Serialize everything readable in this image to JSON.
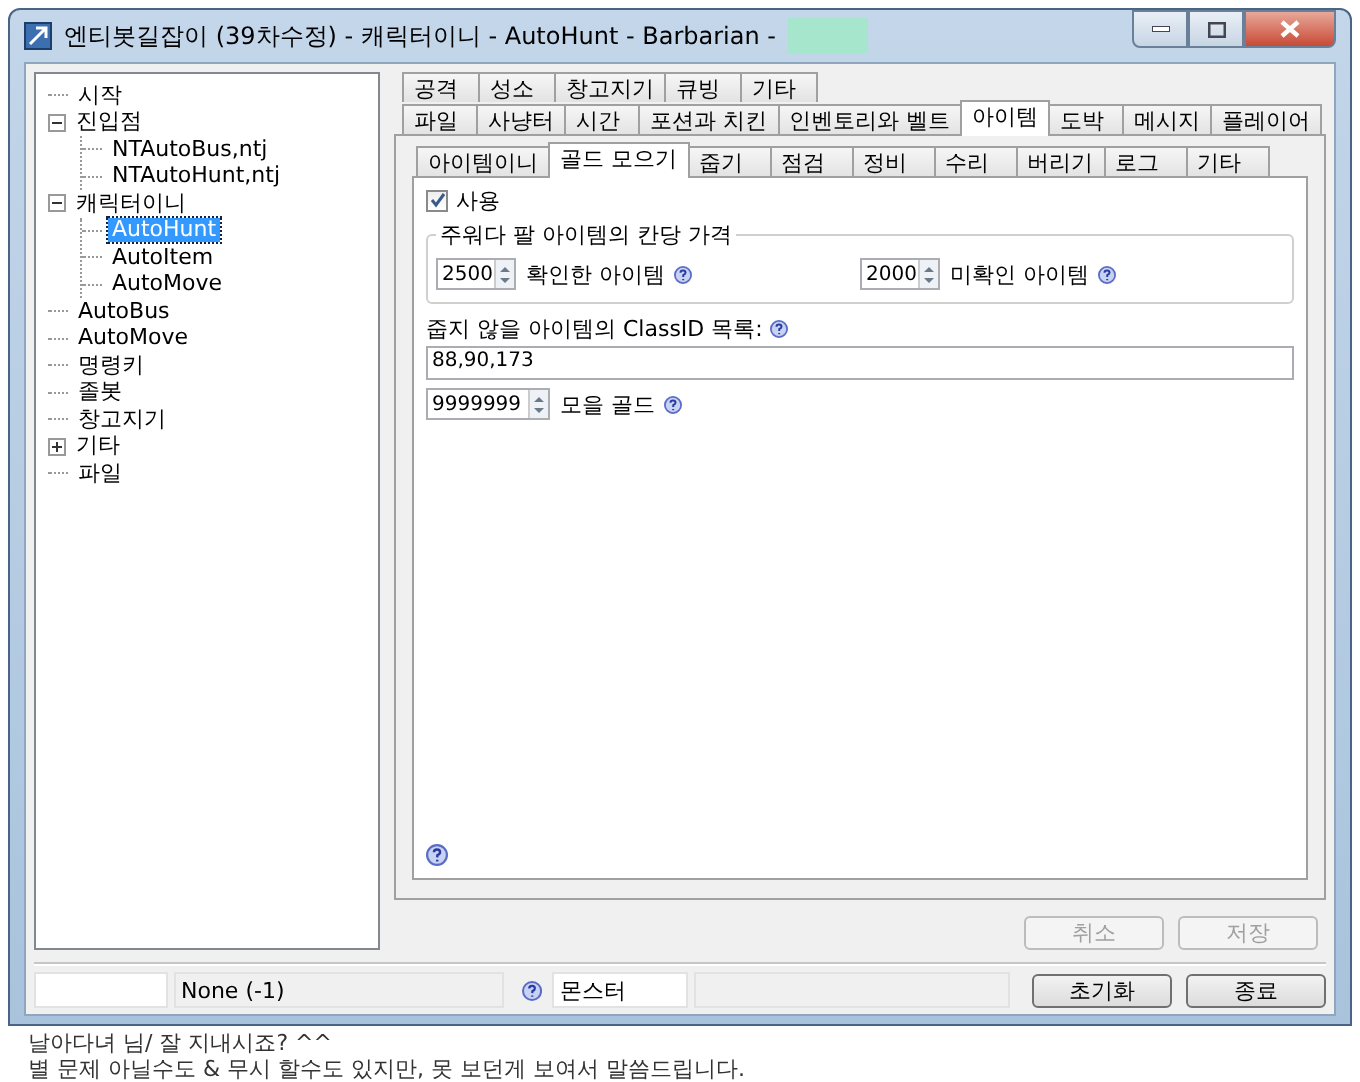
{
  "window": {
    "title": "엔티봇길잡이 (39차수정) - 캐릭터이니 - AutoHunt - Barbarian -"
  },
  "tree": [
    {
      "label": "시작",
      "selected": false
    },
    {
      "label": "진입점",
      "selected": false,
      "expanded": true,
      "children": [
        {
          "label": "NTAutoBus,ntj",
          "selected": false
        },
        {
          "label": "NTAutoHunt,ntj",
          "selected": false
        }
      ]
    },
    {
      "label": "캐릭터이니",
      "selected": false,
      "expanded": true,
      "children": [
        {
          "label": "AutoHunt",
          "selected": true
        },
        {
          "label": "AutoItem",
          "selected": false
        },
        {
          "label": "AutoMove",
          "selected": false
        }
      ]
    },
    {
      "label": "AutoBus",
      "selected": false
    },
    {
      "label": "AutoMove",
      "selected": false
    },
    {
      "label": "명령키",
      "selected": false
    },
    {
      "label": "졸봇",
      "selected": false
    },
    {
      "label": "창고지기",
      "selected": false
    },
    {
      "label": "기타",
      "selected": false,
      "expanded": false
    },
    {
      "label": "파일",
      "selected": false
    }
  ],
  "tabs_row1": [
    {
      "label": "공격",
      "selected": false
    },
    {
      "label": "성소",
      "selected": false
    },
    {
      "label": "창고지기",
      "selected": false
    },
    {
      "label": "큐빙",
      "selected": false
    },
    {
      "label": "기타",
      "selected": false
    }
  ],
  "tabs_row2": [
    {
      "label": "파일",
      "selected": false
    },
    {
      "label": "사냥터",
      "selected": false
    },
    {
      "label": "시간",
      "selected": false
    },
    {
      "label": "포션과 치킨",
      "selected": false
    },
    {
      "label": "인벤토리와 벨트",
      "selected": false
    },
    {
      "label": "아이템",
      "selected": true
    },
    {
      "label": "도박",
      "selected": false
    },
    {
      "label": "메시지",
      "selected": false
    },
    {
      "label": "플레이어",
      "selected": false
    }
  ],
  "subtabs": [
    {
      "label": "아이템이니",
      "selected": false
    },
    {
      "label": "골드 모으기",
      "selected": true
    },
    {
      "label": "줍기",
      "selected": false
    },
    {
      "label": "점검",
      "selected": false
    },
    {
      "label": "정비",
      "selected": false
    },
    {
      "label": "수리",
      "selected": false
    },
    {
      "label": "버리기",
      "selected": false
    },
    {
      "label": "로그",
      "selected": false
    },
    {
      "label": "기타",
      "selected": false
    }
  ],
  "panel": {
    "use": {
      "label": "사용",
      "checked": true
    },
    "group": {
      "title": "주워다 팔 아이템의 칸당 가격",
      "spinners": [
        {
          "value": "2500",
          "label": "확인한 아이템"
        },
        {
          "value": "2000",
          "label": "미확인 아이템"
        }
      ]
    },
    "classid": {
      "label": "줍지 않을 아이템의 ClassID 목록:",
      "value": "88,90,173"
    },
    "gold": {
      "value": "9999999",
      "label": "모을 골드"
    }
  },
  "actions": [
    {
      "label": "취소",
      "disabled": true
    },
    {
      "label": "저장",
      "disabled": true
    }
  ],
  "status_bar": {
    "value": "None (-1)",
    "monster": "몬스터",
    "buttons": [
      {
        "label": "초기화",
        "disabled": false
      },
      {
        "label": "종료",
        "disabled": false
      }
    ]
  },
  "background_text": [
    "날아다녀 님/ 잘 지내시죠? ^^",
    "별 문제 아닐수도 & 무시 할수도 있지만, 못 보던게 보여서 말씀드립니다."
  ]
}
